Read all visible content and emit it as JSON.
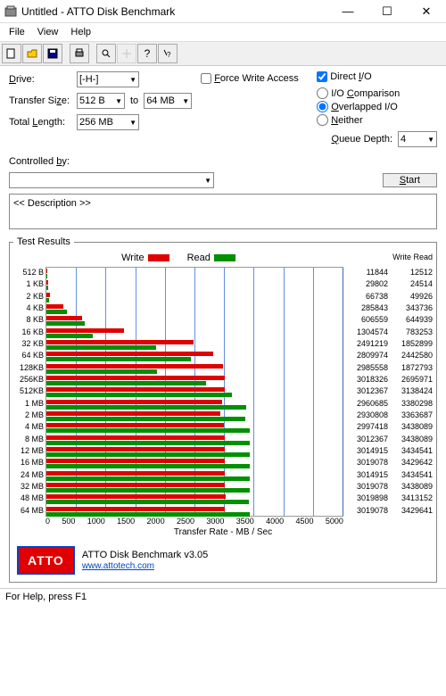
{
  "window": {
    "title": "Untitled - ATTO Disk Benchmark"
  },
  "menu": {
    "file": "File",
    "view": "View",
    "help": "Help"
  },
  "form": {
    "drive_label": "Drive:",
    "drive_value": "[-H-]",
    "transfer_label": "Transfer Size:",
    "transfer_from": "512 B",
    "to": "to",
    "transfer_to": "64 MB",
    "length_label": "Total Length:",
    "length_value": "256 MB",
    "force_write": "Force Write Access",
    "direct_io": "Direct I/O",
    "io_comparison": "I/O Comparison",
    "overlapped": "Overlapped I/O",
    "neither": "Neither",
    "queue_label": "Queue Depth:",
    "queue_value": "4",
    "controlled_label": "Controlled by:",
    "start": "Start",
    "description": "<< Description >>"
  },
  "results": {
    "legend_title": "Test Results",
    "write": "Write",
    "read": "Read",
    "xlabel": "Transfer Rate - MB / Sec"
  },
  "chart_data": {
    "type": "bar",
    "xlabel": "Transfer Rate - MB / Sec",
    "xlim": [
      0,
      5000
    ],
    "xticks": [
      0,
      500,
      1000,
      1500,
      2000,
      2500,
      3000,
      3500,
      4000,
      4500,
      5000
    ],
    "categories": [
      "512 B",
      "1 KB",
      "2 KB",
      "4 KB",
      "8 KB",
      "16 KB",
      "32 KB",
      "64 KB",
      "128KB",
      "256KB",
      "512KB",
      "1 MB",
      "2 MB",
      "4 MB",
      "8 MB",
      "12 MB",
      "16 MB",
      "24 MB",
      "32 MB",
      "48 MB",
      "64 MB"
    ],
    "series": [
      {
        "name": "Write",
        "color": "#e00000",
        "values": [
          11844,
          29802,
          66738,
          285843,
          606559,
          1304574,
          2491219,
          2809974,
          2985558,
          3018326,
          3012367,
          2960685,
          2930808,
          2997418,
          3012367,
          3014915,
          3019078,
          3014915,
          3019078,
          3019898,
          3019078
        ]
      },
      {
        "name": "Read",
        "color": "#009000",
        "values": [
          12512,
          24514,
          49926,
          343736,
          644939,
          783253,
          1852899,
          2442580,
          1872793,
          2695971,
          3138424,
          3380298,
          3363687,
          3438089,
          3438089,
          3434541,
          3429642,
          3434541,
          3438089,
          3413152,
          3429641
        ]
      }
    ]
  },
  "footer": {
    "logo": "ATTO",
    "product": "ATTO Disk Benchmark v3.05",
    "url": "www.attotech.com"
  },
  "status": "For Help, press F1"
}
